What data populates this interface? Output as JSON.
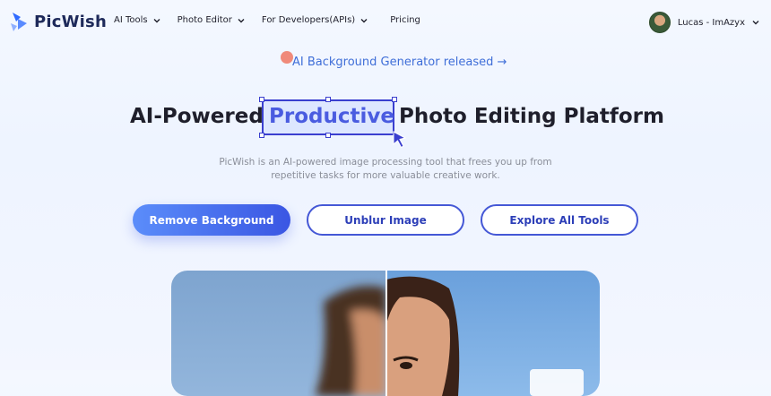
{
  "brand": {
    "name": "PicWish",
    "accent": "#4a5ce0"
  },
  "nav": {
    "items": [
      {
        "label": "AI Tools",
        "has_dropdown": true
      },
      {
        "label": "Photo Editor",
        "has_dropdown": true
      },
      {
        "label": "For Developers(APIs)",
        "has_dropdown": true
      },
      {
        "label": "Pricing",
        "has_dropdown": false
      }
    ]
  },
  "user": {
    "name": "Lucas - ImAzyx",
    "has_dropdown": true
  },
  "announcement": {
    "text": "AI Background Generator released →"
  },
  "hero": {
    "title_left": "AI-Powered",
    "title_highlight": "Productive",
    "title_right": "Photo Editing Platform",
    "subtitle_line1": "PicWish is an AI-powered image processing tool that frees you up from",
    "subtitle_line2": "repetitive tasks for more valuable creative work."
  },
  "buttons": {
    "remove_bg": "Remove Background",
    "unblur": "Unblur Image",
    "explore": "Explore All Tools"
  },
  "compare": {
    "icons": [
      "before-blurred-image",
      "after-sharp-image"
    ]
  }
}
